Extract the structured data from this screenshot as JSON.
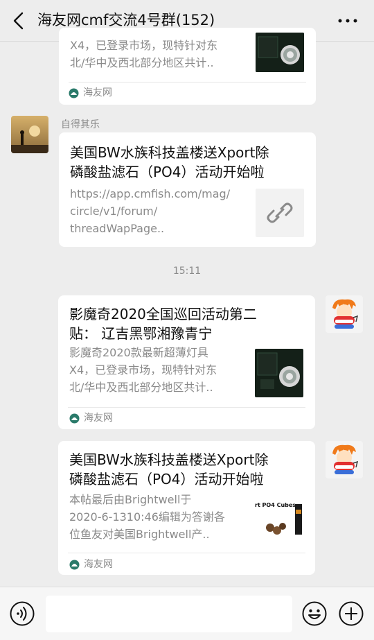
{
  "header": {
    "title": "海友网cmf交流4号群(152)"
  },
  "messages": [
    {
      "desc_lines": [
        "X4，已登录市场，现特针对东",
        "北/华中及西北部分地区共计.."
      ],
      "source": "海友网"
    },
    {
      "sender": "自得其乐",
      "title_lines": [
        "美国BW水族科技盖楼送Xport除",
        "磷酸盐滤石（PO4）活动开始啦"
      ],
      "url_lines": [
        "https://app.cmfish.com/mag/",
        "circle/v1/forum/",
        "threadWapPage.."
      ]
    },
    {
      "time": "15:11"
    },
    {
      "title_lines": [
        "影魔奇2020全国巡回活动第二",
        "贴： 辽吉黑鄂湘豫青宁"
      ],
      "desc_lines": [
        "影魔奇2020款最新超薄灯具",
        "X4，已登录市场，现特针对东",
        "北/华中及西北部分地区共计.."
      ],
      "source": "海友网"
    },
    {
      "title_lines": [
        "美国BW水族科技盖楼送Xport除",
        "磷酸盐滤石（PO4）活动开始啦"
      ],
      "desc_lines": [
        "本帖最后由Brightwell于",
        "2020-6-1310:46编辑为答谢各",
        "位鱼友对美国Brightwell产.."
      ],
      "source": "海友网",
      "thumb_text": "rt PO4 Cubes"
    }
  ],
  "footer": {
    "input_value": "",
    "input_placeholder": ""
  }
}
